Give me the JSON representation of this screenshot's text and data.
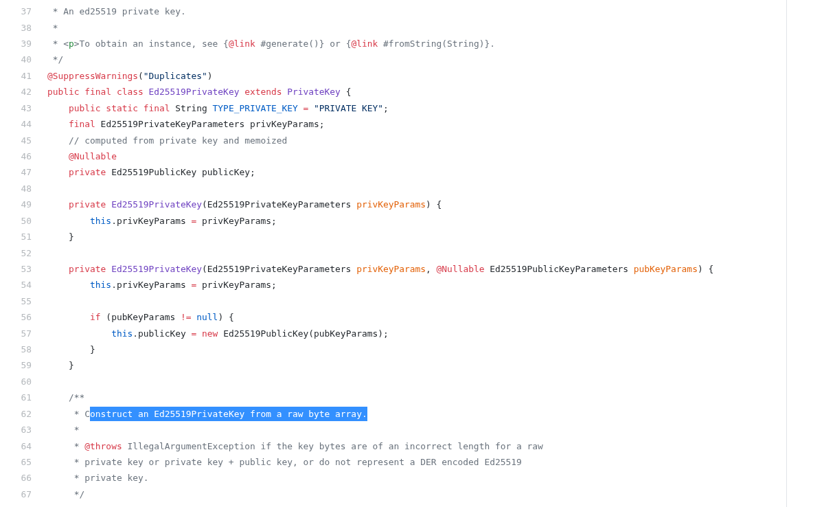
{
  "code_lines": [
    {
      "number": "37",
      "tokens": [
        {
          "kind": "comment",
          "text": " * An ed25519 private key."
        }
      ]
    },
    {
      "number": "38",
      "tokens": [
        {
          "kind": "comment",
          "text": " *"
        }
      ]
    },
    {
      "number": "39",
      "tokens": [
        {
          "kind": "comment",
          "text": " * <"
        },
        {
          "kind": "tag",
          "text": "p"
        },
        {
          "kind": "comment",
          "text": ">To obtain an instance, see {"
        },
        {
          "kind": "keyword",
          "text": "@link"
        },
        {
          "kind": "comment",
          "text": " #generate()} or {"
        },
        {
          "kind": "keyword",
          "text": "@link"
        },
        {
          "kind": "comment",
          "text": " #fromString(String)}."
        }
      ]
    },
    {
      "number": "40",
      "tokens": [
        {
          "kind": "comment",
          "text": " */"
        }
      ]
    },
    {
      "number": "41",
      "tokens": [
        {
          "kind": "keyword",
          "text": "@SuppressWarnings"
        },
        {
          "kind": "plain",
          "text": "("
        },
        {
          "kind": "string",
          "text": "\"Duplicates\""
        },
        {
          "kind": "plain",
          "text": ")"
        }
      ]
    },
    {
      "number": "42",
      "tokens": [
        {
          "kind": "keyword",
          "text": "public final class "
        },
        {
          "kind": "entity",
          "text": "Ed25519PrivateKey"
        },
        {
          "kind": "keyword",
          "text": " extends "
        },
        {
          "kind": "entity",
          "text": "PrivateKey"
        },
        {
          "kind": "plain",
          "text": " {"
        }
      ]
    },
    {
      "number": "43",
      "tokens": [
        {
          "kind": "keyword",
          "text": "    public static final "
        },
        {
          "kind": "plain",
          "text": "String "
        },
        {
          "kind": "constant",
          "text": "TYPE_PRIVATE_KEY"
        },
        {
          "kind": "keyword",
          "text": " = "
        },
        {
          "kind": "string",
          "text": "\"PRIVATE KEY\""
        },
        {
          "kind": "plain",
          "text": ";"
        }
      ]
    },
    {
      "number": "44",
      "tokens": [
        {
          "kind": "keyword",
          "text": "    final"
        },
        {
          "kind": "plain",
          "text": " Ed25519PrivateKeyParameters privKeyParams;"
        }
      ]
    },
    {
      "number": "45",
      "tokens": [
        {
          "kind": "comment",
          "text": "    // computed from private key and memoized"
        }
      ]
    },
    {
      "number": "46",
      "tokens": [
        {
          "kind": "keyword",
          "text": "    @Nullable"
        }
      ]
    },
    {
      "number": "47",
      "tokens": [
        {
          "kind": "keyword",
          "text": "    private"
        },
        {
          "kind": "plain",
          "text": " Ed25519PublicKey publicKey;"
        }
      ]
    },
    {
      "number": "48"
    },
    {
      "number": "49",
      "tokens": [
        {
          "kind": "keyword",
          "text": "    private "
        },
        {
          "kind": "entity",
          "text": "Ed25519PrivateKey"
        },
        {
          "kind": "plain",
          "text": "(Ed25519PrivateKeyParameters "
        },
        {
          "kind": "parameter",
          "text": "privKeyParams"
        },
        {
          "kind": "plain",
          "text": ") {"
        }
      ]
    },
    {
      "number": "50",
      "tokens": [
        {
          "kind": "constant",
          "text": "        this"
        },
        {
          "kind": "plain",
          "text": ".privKeyParams "
        },
        {
          "kind": "keyword",
          "text": "="
        },
        {
          "kind": "plain",
          "text": " privKeyParams;"
        }
      ]
    },
    {
      "number": "51",
      "tokens": [
        {
          "kind": "plain",
          "text": "    }"
        }
      ]
    },
    {
      "number": "52"
    },
    {
      "number": "53",
      "tokens": [
        {
          "kind": "keyword",
          "text": "    private "
        },
        {
          "kind": "entity",
          "text": "Ed25519PrivateKey"
        },
        {
          "kind": "plain",
          "text": "(Ed25519PrivateKeyParameters "
        },
        {
          "kind": "parameter",
          "text": "privKeyParams"
        },
        {
          "kind": "plain",
          "text": ", "
        },
        {
          "kind": "keyword",
          "text": "@Nullable"
        },
        {
          "kind": "plain",
          "text": " Ed25519PublicKeyParameters "
        },
        {
          "kind": "parameter",
          "text": "pubKeyParams"
        },
        {
          "kind": "plain",
          "text": ") {"
        }
      ]
    },
    {
      "number": "54",
      "tokens": [
        {
          "kind": "constant",
          "text": "        this"
        },
        {
          "kind": "plain",
          "text": ".privKeyParams "
        },
        {
          "kind": "keyword",
          "text": "="
        },
        {
          "kind": "plain",
          "text": " privKeyParams;"
        }
      ]
    },
    {
      "number": "55"
    },
    {
      "number": "56",
      "tokens": [
        {
          "kind": "keyword",
          "text": "        if"
        },
        {
          "kind": "plain",
          "text": " (pubKeyParams "
        },
        {
          "kind": "keyword",
          "text": "!="
        },
        {
          "kind": "constant",
          "text": " null"
        },
        {
          "kind": "plain",
          "text": ") {"
        }
      ]
    },
    {
      "number": "57",
      "tokens": [
        {
          "kind": "constant",
          "text": "            this"
        },
        {
          "kind": "plain",
          "text": ".publicKey "
        },
        {
          "kind": "keyword",
          "text": "="
        },
        {
          "kind": "keyword",
          "text": " new"
        },
        {
          "kind": "plain",
          "text": " Ed25519PublicKey(pubKeyParams);"
        }
      ]
    },
    {
      "number": "58",
      "tokens": [
        {
          "kind": "plain",
          "text": "        }"
        }
      ]
    },
    {
      "number": "59",
      "tokens": [
        {
          "kind": "plain",
          "text": "    }"
        }
      ]
    },
    {
      "number": "60"
    },
    {
      "number": "61",
      "tokens": [
        {
          "kind": "comment",
          "text": "    /**"
        }
      ]
    },
    {
      "number": "62",
      "tokens": [
        {
          "kind": "comment",
          "text": "     * C"
        },
        {
          "kind": "selection",
          "text": "onstruct an Ed25519PrivateKey from a raw byte array."
        }
      ]
    },
    {
      "number": "63",
      "tokens": [
        {
          "kind": "comment",
          "text": "     *"
        }
      ]
    },
    {
      "number": "64",
      "tokens": [
        {
          "kind": "comment",
          "text": "     * "
        },
        {
          "kind": "keyword",
          "text": "@throws"
        },
        {
          "kind": "comment",
          "text": " IllegalArgumentException if the key bytes are of an incorrect length for a raw"
        }
      ]
    },
    {
      "number": "65",
      "tokens": [
        {
          "kind": "comment",
          "text": "     * private key or private key + public key, or do not represent a DER encoded Ed25519"
        }
      ]
    },
    {
      "number": "66",
      "tokens": [
        {
          "kind": "comment",
          "text": "     * private key."
        }
      ]
    },
    {
      "number": "67",
      "tokens": [
        {
          "kind": "comment",
          "text": "     */"
        }
      ]
    }
  ]
}
